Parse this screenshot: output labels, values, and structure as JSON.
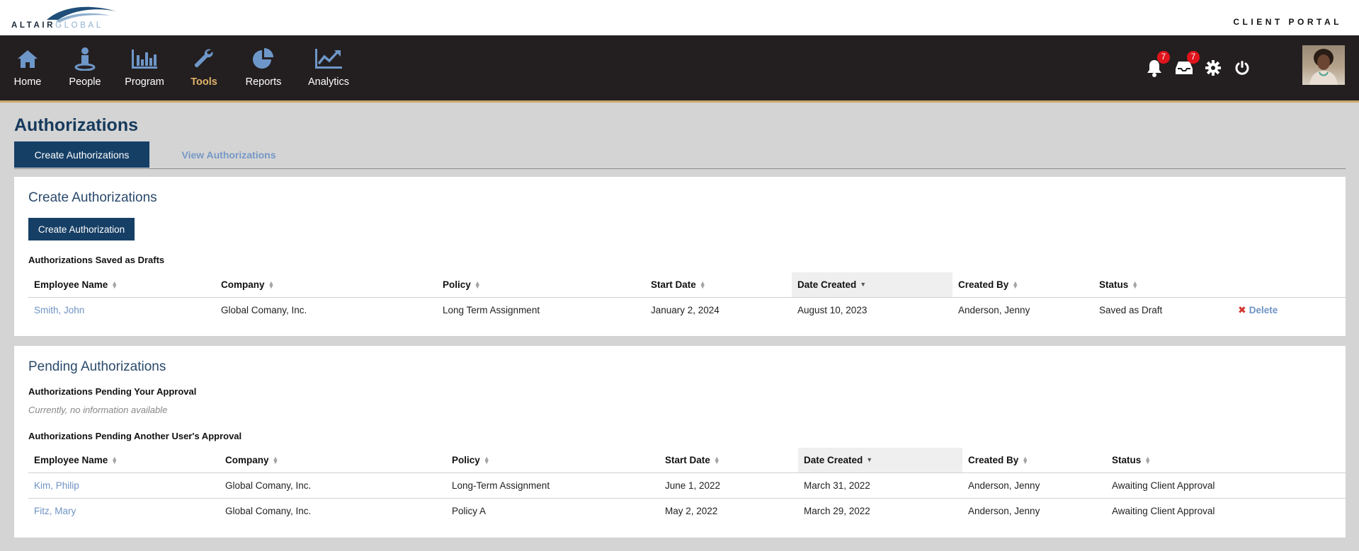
{
  "header": {
    "logo_primary": "ALTAIR",
    "logo_secondary": "GLOBAL",
    "portal_label": "CLIENT PORTAL"
  },
  "nav": {
    "items": [
      {
        "label": "Home",
        "icon": "home-icon"
      },
      {
        "label": "People",
        "icon": "person-icon"
      },
      {
        "label": "Program",
        "icon": "bar-chart-icon"
      },
      {
        "label": "Tools",
        "icon": "wrench-icon",
        "active": true
      },
      {
        "label": "Reports",
        "icon": "pie-chart-icon"
      },
      {
        "label": "Analytics",
        "icon": "line-chart-icon"
      }
    ],
    "notifications_count": "7",
    "inbox_count": "7"
  },
  "page": {
    "title": "Authorizations",
    "tabs": [
      {
        "label": "Create Authorizations",
        "active": true
      },
      {
        "label": "View Authorizations",
        "active": false
      }
    ]
  },
  "create_panel": {
    "title": "Create Authorizations",
    "button_label": "Create Authorization",
    "drafts_heading": "Authorizations Saved as Drafts",
    "columns": [
      "Employee Name",
      "Company",
      "Policy",
      "Start Date",
      "Date Created",
      "Created By",
      "Status"
    ],
    "rows": [
      {
        "employee": "Smith, John",
        "company": "Global Comany, Inc.",
        "policy": "Long Term Assignment",
        "start": "January 2, 2024",
        "created": "August 10, 2023",
        "by": "Anderson, Jenny",
        "status": "Saved as Draft",
        "action": "Delete"
      }
    ]
  },
  "pending_panel": {
    "title": "Pending Authorizations",
    "your_heading": "Authorizations Pending Your Approval",
    "empty_note": "Currently, no information available",
    "other_heading": "Authorizations Pending Another User's Approval",
    "columns": [
      "Employee Name",
      "Company",
      "Policy",
      "Start Date",
      "Date Created",
      "Created By",
      "Status"
    ],
    "rows": [
      {
        "employee": "Kim, Philip",
        "company": "Global Comany, Inc.",
        "policy": "Long-Term Assignment",
        "start": "June 1, 2022",
        "created": "March 31, 2022",
        "by": "Anderson, Jenny",
        "status": "Awaiting Client Approval"
      },
      {
        "employee": "Fitz, Mary",
        "company": "Global Comany, Inc.",
        "policy": "Policy A",
        "start": "May 2, 2022",
        "created": "March 29, 2022",
        "by": "Anderson, Jenny",
        "status": "Awaiting Client Approval"
      }
    ]
  },
  "colors": {
    "nav_bg": "#231f20",
    "accent_gold": "#e1b36a",
    "primary_blue": "#163f66",
    "link_blue": "#6f93c3",
    "badge_red": "#e0141c"
  }
}
